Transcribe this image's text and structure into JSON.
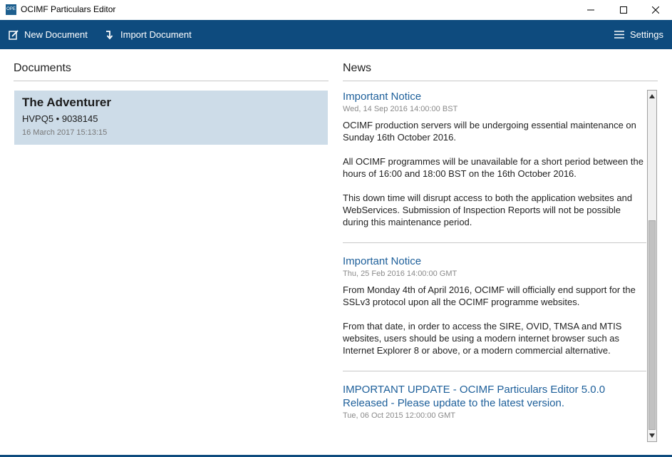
{
  "window": {
    "title": "OCIMF Particulars Editor",
    "icon_text": "OPE",
    "controls": [
      "minimize-icon",
      "maximize-icon",
      "close-icon"
    ]
  },
  "toolbar": {
    "new_document_label": "New Document",
    "import_document_label": "Import Document",
    "settings_label": "Settings",
    "background_color": "#0e4b7e"
  },
  "documents": {
    "heading": "Documents",
    "items": [
      {
        "name": "The Adventurer",
        "identifier": "HVPQ5 • 9038145",
        "date": "16 March 2017 15:13:15"
      }
    ]
  },
  "news": {
    "heading": "News",
    "items": [
      {
        "title": "Important Notice",
        "date": "Wed, 14 Sep 2016 14:00:00 BST",
        "paragraphs": [
          "OCIMF production servers will be undergoing essential maintenance on Sunday 16th October 2016.",
          "All OCIMF programmes will be unavailable for a short period between the hours of 16:00 and 18:00 BST on the 16th October 2016.",
          "This down time will disrupt access to both the application websites and WebServices. Submission of Inspection Reports will not be possible during this maintenance period."
        ]
      },
      {
        "title": "Important Notice",
        "date": "Thu, 25 Feb 2016 14:00:00 GMT",
        "paragraphs": [
          "From Monday 4th of April 2016, OCIMF will officially end support for the SSLv3 protocol upon all the OCIMF programme websites.",
          "From that date, in order to access the SIRE, OVID, TMSA and MTIS websites, users should be using a modern internet browser such as Internet Explorer 8 or above, or a modern commercial alternative."
        ]
      },
      {
        "title": "IMPORTANT UPDATE - OCIMF Particulars Editor 5.0.0 Released - Please update to the latest version.",
        "date": "Tue, 06 Oct 2015 12:00:00 GMT",
        "paragraphs": []
      }
    ]
  }
}
